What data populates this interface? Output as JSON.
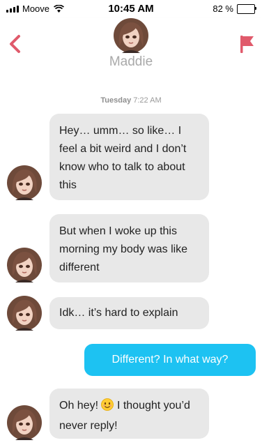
{
  "status_bar": {
    "carrier": "Moove",
    "time": "10:45 AM",
    "battery_percent": "82 %",
    "battery_level": 0.82
  },
  "header": {
    "contact_name": "Maddie",
    "back_icon": "chevron-left-icon",
    "report_icon": "flag-icon",
    "accent_color": "#e05a6b"
  },
  "timestamp": {
    "day": "Tuesday",
    "time": "7:22 AM"
  },
  "messages": [
    {
      "from": "Maddie",
      "text": "Hey… umm… so like… I feel a bit weird and I don’t know who to talk to about this"
    },
    {
      "from": "Maddie",
      "text": "But when I woke up this morning my body was like different"
    },
    {
      "from": "Maddie",
      "text": "Idk… it’s hard to explain"
    },
    {
      "from": "me",
      "text": "Different? In what way?"
    },
    {
      "from": "Maddie",
      "text_before": "Oh hey!",
      "emoji": "😊",
      "text_after": "I thought you’d never reply!"
    }
  ],
  "colors": {
    "incoming_bubble": "#e8e8e8",
    "outgoing_bubble": "#1dc2f2",
    "name_gray": "#a9a9a9"
  }
}
